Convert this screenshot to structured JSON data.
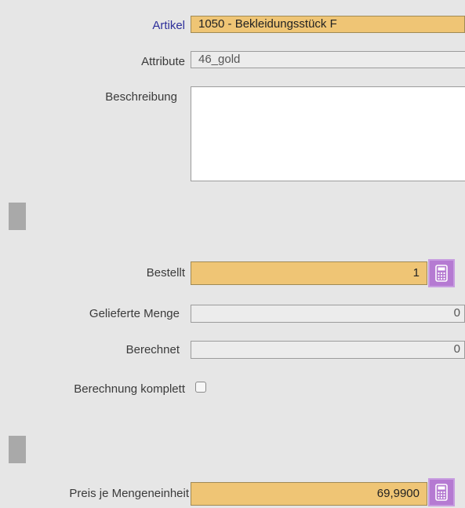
{
  "form": {
    "artikel": {
      "label": "Artikel",
      "value": "1050 - Bekleidungsstück F"
    },
    "attribute": {
      "label": "Attribute",
      "value": "46_gold"
    },
    "beschreibung": {
      "label": "Beschreibung",
      "value": ""
    },
    "bestellt": {
      "label": "Bestellt",
      "value": "1"
    },
    "gelieferte_menge": {
      "label": "Gelieferte Menge",
      "value": "0"
    },
    "berechnet": {
      "label": "Berechnet",
      "value": "0"
    },
    "berechnung_komplett": {
      "label": "Berechnung komplett",
      "checked": false
    },
    "preis_je_mengeneinheit": {
      "label": "Preis je Mengeneinheit",
      "value": "69,9900"
    }
  },
  "icons": {
    "calculator": "calculator-icon",
    "section_grip": "drag-handle"
  },
  "colors": {
    "required_field": "#efc575",
    "calculator_button": "#b57ad2",
    "link_label": "#2d2f9a",
    "background": "#e6e6e6"
  }
}
